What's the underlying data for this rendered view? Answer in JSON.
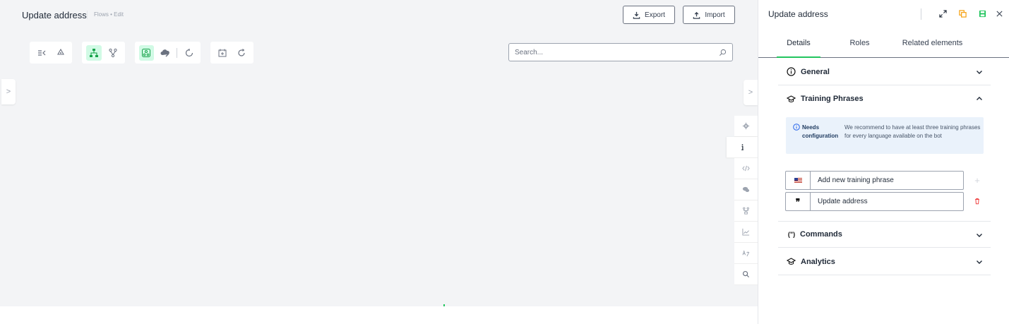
{
  "header": {
    "title": "Update address",
    "breadcrumb": "Flows • Edit",
    "export_label": "Export",
    "import_label": "Import"
  },
  "toolbar": {
    "groups": [
      {
        "tools": [
          {
            "icon": "collapse-menu-icon",
            "active": false
          },
          {
            "icon": "recycle-icon",
            "active": false
          }
        ]
      },
      {
        "tools": [
          {
            "icon": "hierarchy-icon",
            "active": true
          },
          {
            "icon": "branch-icon",
            "active": false
          }
        ]
      },
      {
        "tools": [
          {
            "icon": "auto-layout-icon",
            "active": true
          },
          {
            "icon": "cloud-edit-icon",
            "active": false
          },
          {
            "icon": "sync-icon",
            "active": false
          }
        ]
      },
      {
        "tools": [
          {
            "icon": "calendar-plus-icon",
            "active": false
          },
          {
            "icon": "refresh-icon",
            "active": false
          }
        ]
      }
    ]
  },
  "search": {
    "placeholder": "Search..."
  },
  "rail": {
    "items": [
      {
        "icon": "gear-icon",
        "active": false
      },
      {
        "icon": "info-icon",
        "active": true
      },
      {
        "icon": "code-icon",
        "active": false
      },
      {
        "icon": "chat-icon",
        "active": false
      },
      {
        "icon": "flow-icon",
        "active": false
      },
      {
        "icon": "chart-icon",
        "active": false
      },
      {
        "icon": "translate-icon",
        "active": false
      },
      {
        "icon": "search-icon",
        "active": false
      }
    ]
  },
  "panel": {
    "title": "Update address",
    "tabs": [
      {
        "label": "Details",
        "active": true
      },
      {
        "label": "Roles",
        "active": false
      },
      {
        "label": "Related elements",
        "active": false
      }
    ],
    "sections": {
      "general": {
        "label": "General",
        "expanded": false
      },
      "training": {
        "label": "Training Phrases",
        "expanded": true
      },
      "commands": {
        "label": "Commands",
        "icon_text": "(\")",
        "expanded": false
      },
      "analytics": {
        "label": "Analytics",
        "expanded": false
      }
    },
    "notice": {
      "heading": "Needs configuration",
      "text": "We recommend to have at least three training phrases for every language available on the bot"
    },
    "phrases": {
      "new_placeholder": "Add new training phrase",
      "existing": [
        {
          "text": "Update address"
        }
      ]
    }
  },
  "colors": {
    "accent": "#22c55e",
    "danger": "#ef4444",
    "notice_bg": "#eaf2fb"
  }
}
